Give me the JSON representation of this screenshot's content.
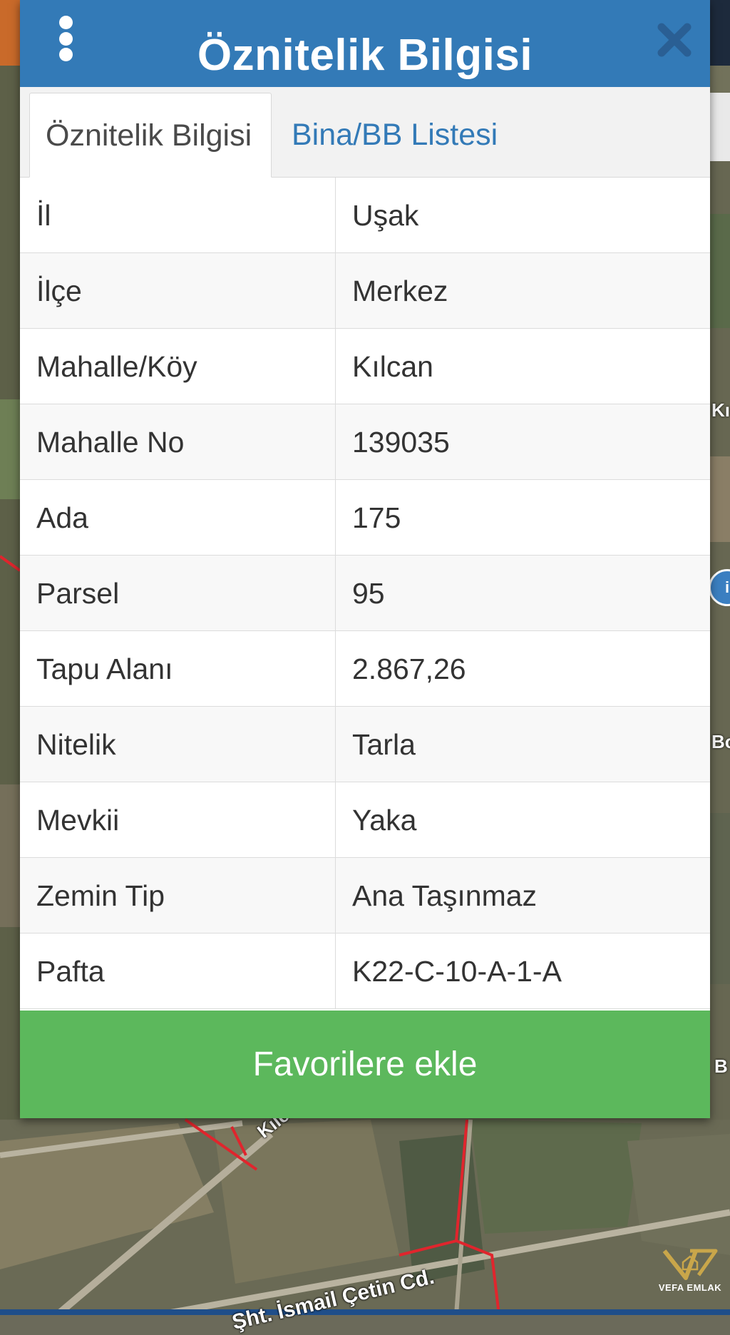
{
  "header": {
    "title": "Öznitelik Bilgisi",
    "menu_icon": "kebab-menu-icon",
    "close_icon": "close-icon"
  },
  "tabs": [
    {
      "label": "Öznitelik Bilgisi",
      "active": true
    },
    {
      "label": "Bina/BB Listesi",
      "active": false
    }
  ],
  "rows": [
    {
      "label": "İl",
      "value": "Uşak"
    },
    {
      "label": "İlçe",
      "value": "Merkez"
    },
    {
      "label": "Mahalle/Köy",
      "value": "Kılcan"
    },
    {
      "label": "Mahalle No",
      "value": "139035"
    },
    {
      "label": "Ada",
      "value": "175"
    },
    {
      "label": "Parsel",
      "value": "95"
    },
    {
      "label": "Tapu Alanı",
      "value": "2.867,26"
    },
    {
      "label": "Nitelik",
      "value": "Tarla"
    },
    {
      "label": "Mevkii",
      "value": "Yaka"
    },
    {
      "label": "Zemin Tip",
      "value": "Ana Taşınmaz"
    },
    {
      "label": "Pafta",
      "value": "K22-C-10-A-1-A"
    }
  ],
  "favorite_button": {
    "label": "Favorilere ekle"
  },
  "map": {
    "street_1": "Kılcan",
    "street_2": "Şht. İsmail Çetin Cd.",
    "edge_label_1": "Kı",
    "edge_label_2": "Bo",
    "edge_label_3": "B"
  },
  "watermark": {
    "text": "VEFA EMLAK"
  },
  "colors": {
    "header": "#337ab7",
    "tab_link": "#337ab7",
    "favorite_button": "#5cb85c",
    "parcel_line": "#e0252d"
  }
}
